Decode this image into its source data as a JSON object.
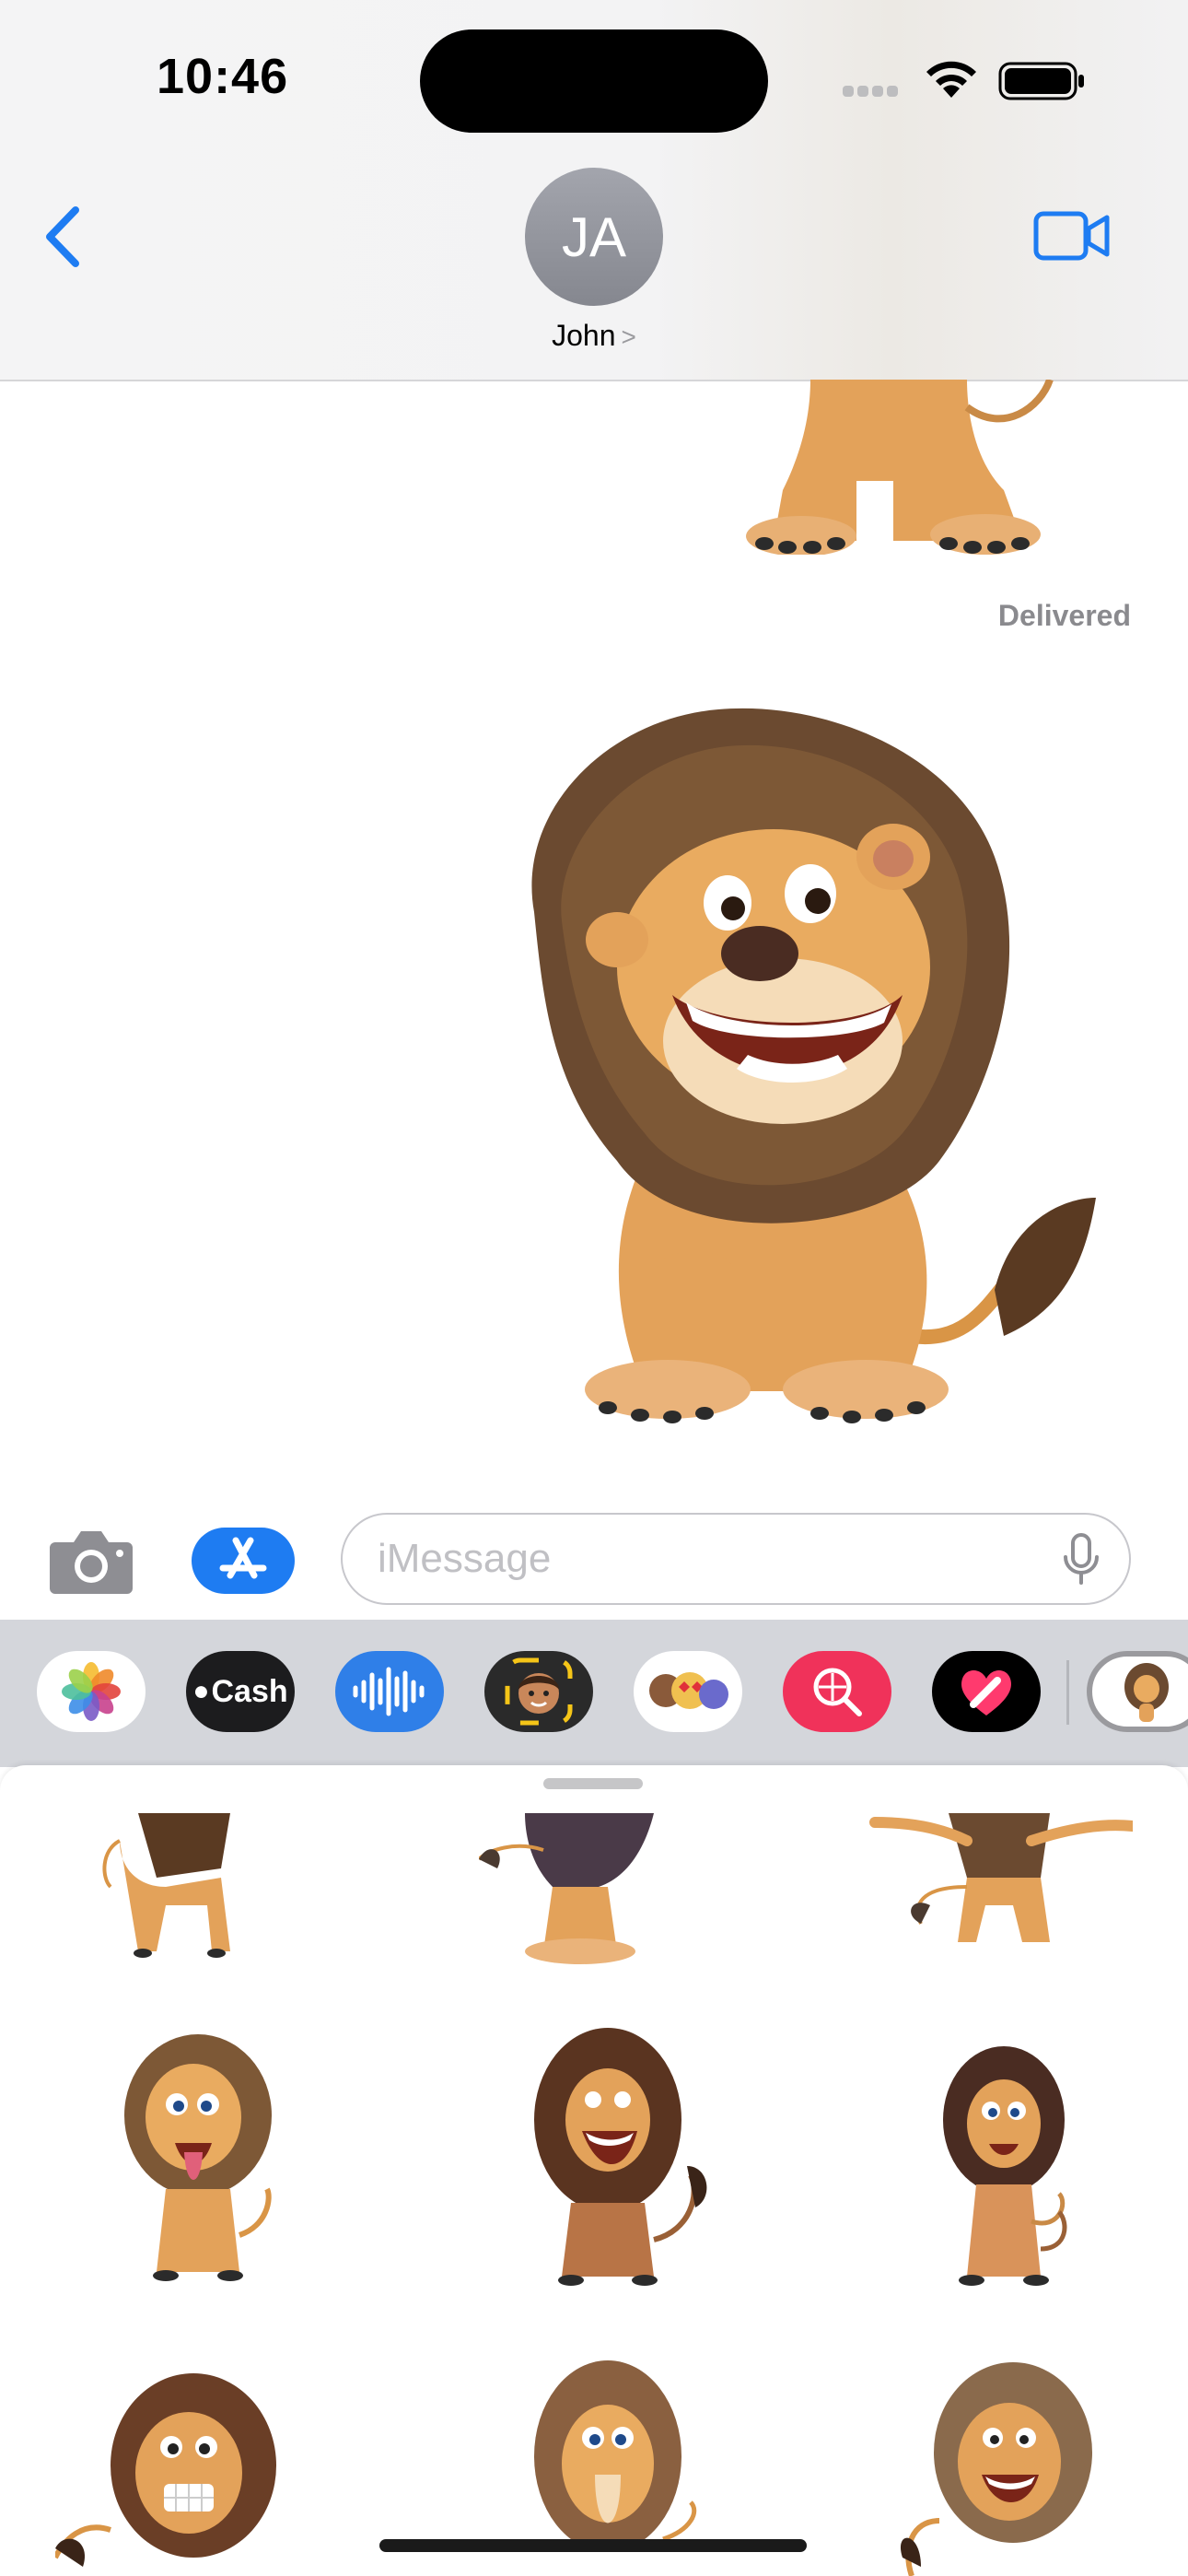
{
  "status_bar": {
    "time": "10:46"
  },
  "header": {
    "avatar_initials": "JA",
    "contact_name": "John",
    "contact_chevron": ">"
  },
  "conversation": {
    "delivered_label": "Delivered"
  },
  "compose": {
    "placeholder": "iMessage"
  },
  "app_drawer": {
    "cash_label": "Cash",
    "apps": [
      "photos-icon",
      "apple-cash-icon",
      "audio-message-icon",
      "memoji-icon",
      "animoji-stickers-icon",
      "search-images-icon",
      "digital-touch-icon",
      "lion-stickers-icon"
    ]
  },
  "colors": {
    "accent": "#1e7cf2",
    "cash_pill": "#1c1c1e",
    "search_pill": "#f0325a",
    "drawer_bg": "#d4d6db"
  }
}
